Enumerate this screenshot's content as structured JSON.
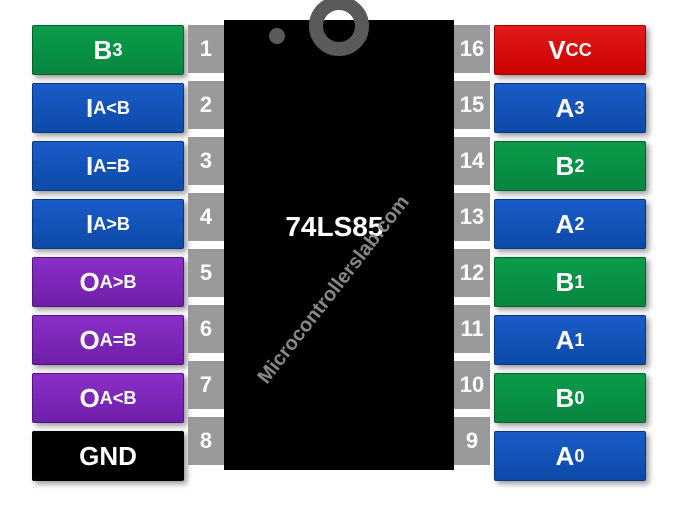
{
  "chip_name": "74LS85",
  "watermark": "Microcontrollerslab.com",
  "left_labels": [
    {
      "main": "B",
      "sub": "3",
      "color": "green"
    },
    {
      "main": "I",
      "sub": "A<B",
      "color": "blue"
    },
    {
      "main": "I",
      "sub": "A=B",
      "color": "blue"
    },
    {
      "main": "I",
      "sub": "A>B",
      "color": "blue"
    },
    {
      "main": "O",
      "sub": "A>B",
      "color": "purple"
    },
    {
      "main": "O",
      "sub": "A=B",
      "color": "purple"
    },
    {
      "main": "O",
      "sub": "A<B",
      "color": "purple"
    },
    {
      "main": "GND",
      "sub": "",
      "color": "black-box"
    }
  ],
  "left_pins": [
    "1",
    "2",
    "3",
    "4",
    "5",
    "6",
    "7",
    "8"
  ],
  "right_pins": [
    "16",
    "15",
    "14",
    "13",
    "12",
    "11",
    "10",
    "9"
  ],
  "right_labels": [
    {
      "main": "V",
      "sub": "CC",
      "color": "red"
    },
    {
      "main": "A",
      "sub": "3",
      "color": "blue"
    },
    {
      "main": "B",
      "sub": "2",
      "color": "green"
    },
    {
      "main": "A",
      "sub": "2",
      "color": "blue"
    },
    {
      "main": "B",
      "sub": "1",
      "color": "green"
    },
    {
      "main": "A",
      "sub": "1",
      "color": "blue"
    },
    {
      "main": "B",
      "sub": "0",
      "color": "green"
    },
    {
      "main": "A",
      "sub": "0",
      "color": "blue"
    }
  ]
}
